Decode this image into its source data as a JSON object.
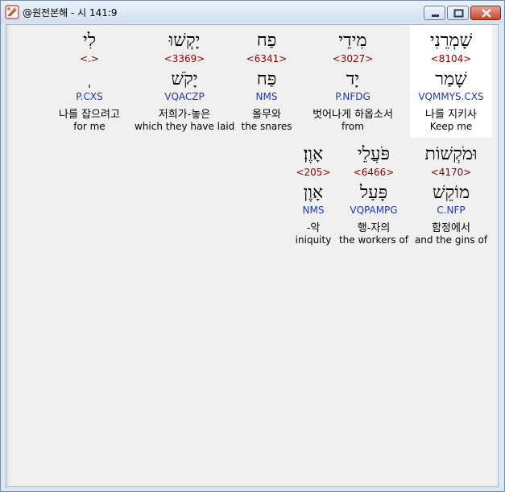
{
  "window": {
    "title": "@원전본해 - 시 141:9"
  },
  "controls": {
    "minimize": "minimize-icon",
    "maximize": "maximize-icon",
    "close": "close-icon"
  },
  "words": [
    {
      "hebrew": "שָׁמְרֵנִי",
      "strong": "<8104>",
      "lemma": "שָׁמַר",
      "parse": "VQMMYS.CXS",
      "korean": "나를 지키사",
      "english": "Keep me",
      "highlighted": true
    },
    {
      "hebrew": "מִידֵי",
      "strong": "<3027>",
      "lemma": "יָד",
      "parse": "P.NFDG",
      "korean": "벗어나게 하옵소서",
      "english": "from"
    },
    {
      "hebrew": "פַח",
      "strong": "<6341>",
      "lemma": "פַּח",
      "parse": "NMS",
      "korean": "올무와",
      "english": "the snares"
    },
    {
      "hebrew": "יָקְשׁוּ",
      "strong": "<3369>",
      "lemma": "יָקֹשׁ",
      "parse": "VQACZP",
      "korean": "저희가-놓은",
      "english": "which they have laid"
    },
    {
      "hebrew": "לִי",
      "strong": "<.>",
      "lemma": "ְ",
      "parse": "P.CXS",
      "korean": "나를 잡으려고",
      "english": "for me"
    },
    {
      "hebrew": "וּמֹקְשׁוֹת",
      "strong": "<4170>",
      "lemma": "מוֹקֵשׁ",
      "parse": "C.NFP",
      "korean": "함정에서",
      "english": "and the gins of"
    },
    {
      "hebrew": "פֹּעֲלֵי",
      "strong": "<6466>",
      "lemma": "פָּעַל",
      "parse": "VQPAMPG",
      "korean": "행-자의",
      "english": "the workers of"
    },
    {
      "hebrew": "אָוֶן׃",
      "strong": "<205>",
      "lemma": "אָוֶן",
      "parse": "NMS",
      "korean": "-악",
      "english": "iniquity"
    }
  ]
}
